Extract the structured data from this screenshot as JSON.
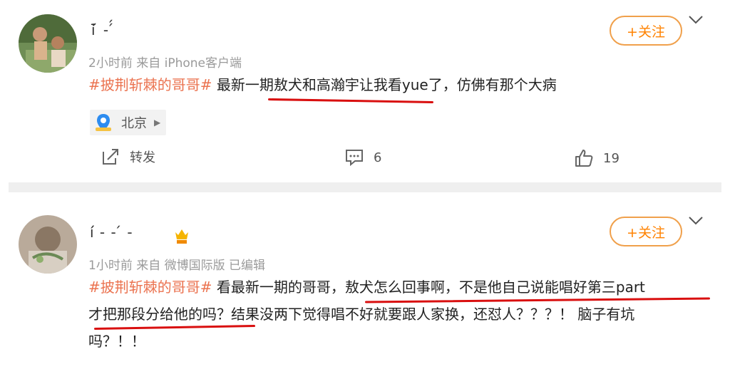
{
  "posts": [
    {
      "username": "ı̇̄ ́ -      ́́",
      "meta": "2小时前  来自 iPhone客户端",
      "follow_label": "+关注",
      "hashtag": "#披荆斩棘的哥哥#",
      "text_line1": "最新一期敖犬和高瀚宇让我看yue了，仿佛有那个大病",
      "location": "北京",
      "repost_label": "转发",
      "comment_count": "6",
      "like_count": "19"
    },
    {
      "username": "ı́́ -  -  ́ -",
      "meta": "1小时前  来自 微博国际版  已编辑",
      "follow_label": "+关注",
      "hashtag": "#披荆斩棘的哥哥#",
      "text_line1": "看最新一期的哥哥，敖犬怎么回事啊，不是他自己说能唱好第三part",
      "text_line2": "才把那段分给他的吗？结果没两下觉得唱不好就要跟人家换，还怼人？？？！ 脑子有坑",
      "text_line3": "吗？！！"
    }
  ],
  "colors": {
    "accent": "#ff8200",
    "hashtag": "#eb7350",
    "underline": "#d90f0f",
    "meta": "#9a9a9a"
  }
}
